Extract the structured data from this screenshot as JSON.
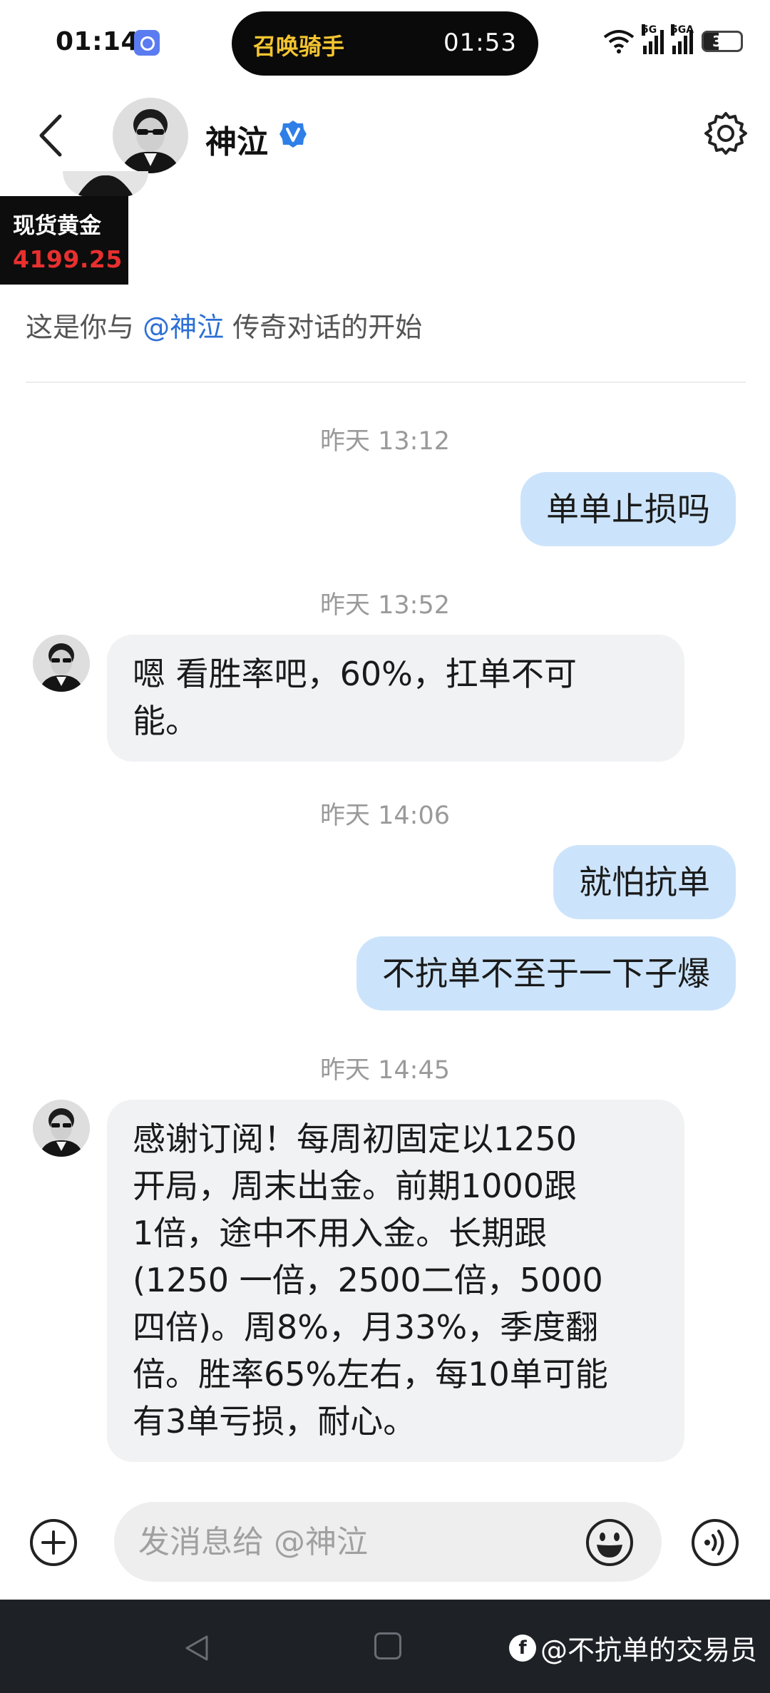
{
  "status_bar": {
    "time": "01:14",
    "island_app": "召唤骑手",
    "island_timer": "01:53",
    "battery": "32",
    "signal_labels": [
      "5G",
      "5GA"
    ]
  },
  "header": {
    "name": "神泣",
    "verified": true
  },
  "ticker": {
    "label": "现货黄金",
    "value": "4199.25"
  },
  "intro": {
    "prefix": "这是你与 ",
    "mention": "@神泣",
    "suffix": " 传奇对话的开始"
  },
  "messages": [
    {
      "type": "timestamp",
      "text": "昨天 13:12"
    },
    {
      "type": "outgoing",
      "text": "单单止损吗"
    },
    {
      "type": "timestamp",
      "text": "昨天 13:52"
    },
    {
      "type": "incoming",
      "lines": [
        "嗯 看胜率吧，60%，扛单不可",
        "能。"
      ]
    },
    {
      "type": "timestamp",
      "text": "昨天 14:06"
    },
    {
      "type": "outgoing",
      "text": "就怕抗单"
    },
    {
      "type": "outgoing",
      "text": "不抗单不至于一下子爆"
    },
    {
      "type": "timestamp",
      "text": "昨天 14:45"
    },
    {
      "type": "incoming",
      "lines": [
        "感谢订阅！每周初固定以1250",
        "开局，周末出金。前期1000跟",
        "1倍，途中不用入金。长期跟",
        "(1250 一倍，2500二倍，5000",
        "四倍)。周8%，月33%，季度翻",
        "倍。胜率65%左右，每10单可能",
        "有3单亏损，耐心。"
      ]
    }
  ],
  "input": {
    "placeholder": "发消息给 @神泣",
    "value": ""
  },
  "watermark": {
    "logo": "f",
    "text": "@不抗单的交易员"
  },
  "colors": {
    "outgoing_bubble": "#cce4fb",
    "incoming_bubble": "#f1f2f4",
    "mention": "#2c6fd6",
    "ticker_value": "#e8302f",
    "island_app": "#f4c430",
    "nav_bar": "#1e2227"
  },
  "icons": [
    "back-arrow-icon",
    "verified-icon",
    "settings-gear-icon",
    "plus-circle-icon",
    "emoji-icon",
    "voice-icon",
    "nav-back-icon",
    "nav-home-icon"
  ]
}
